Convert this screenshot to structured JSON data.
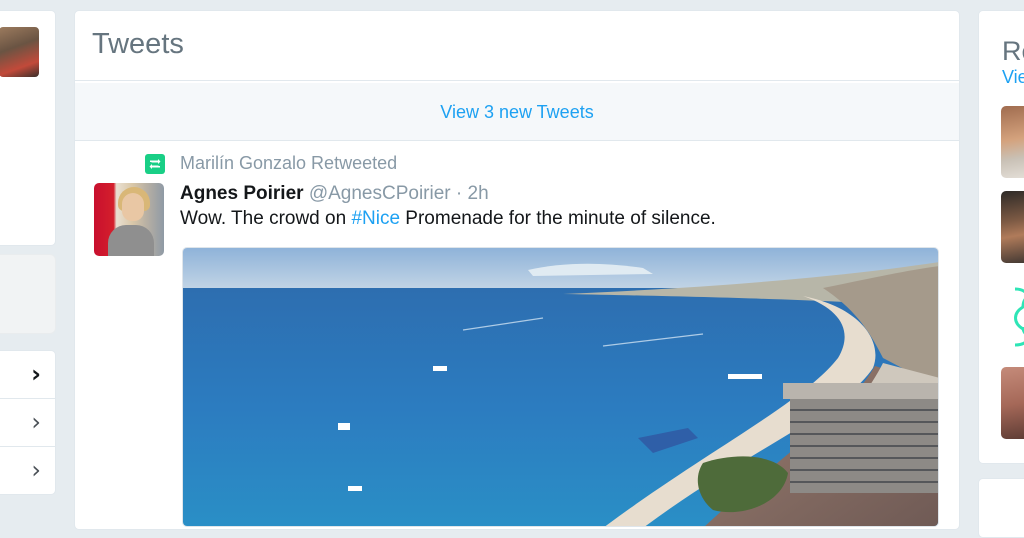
{
  "timeline": {
    "title": "Tweets",
    "new_tweets_banner": "View 3 new Tweets"
  },
  "tweet": {
    "retweeted_by": "Marilín Gonzalo Retweeted",
    "author_name": "Agnes Poirier",
    "author_handle": "@AgnesCPoirier",
    "separator": "·",
    "time": "2h",
    "text_before": "Wow. The crowd on ",
    "hashtag": "#Nice",
    "text_after": " Promenade for the minute of silence."
  },
  "left_nav": {
    "rows": [
      {
        "icon": "chevron-right-icon",
        "glyph": "›"
      },
      {
        "icon": "chevron-right-icon",
        "glyph": "›"
      },
      {
        "icon": "chevron-right-icon",
        "glyph": "›"
      }
    ]
  },
  "right_panel": {
    "title_partial": "Re",
    "link_partial": "Vie"
  },
  "colors": {
    "accent": "#1da1f2",
    "retweet_green": "#19cf86",
    "muted": "#8899a6",
    "background": "#e6ecf0"
  }
}
